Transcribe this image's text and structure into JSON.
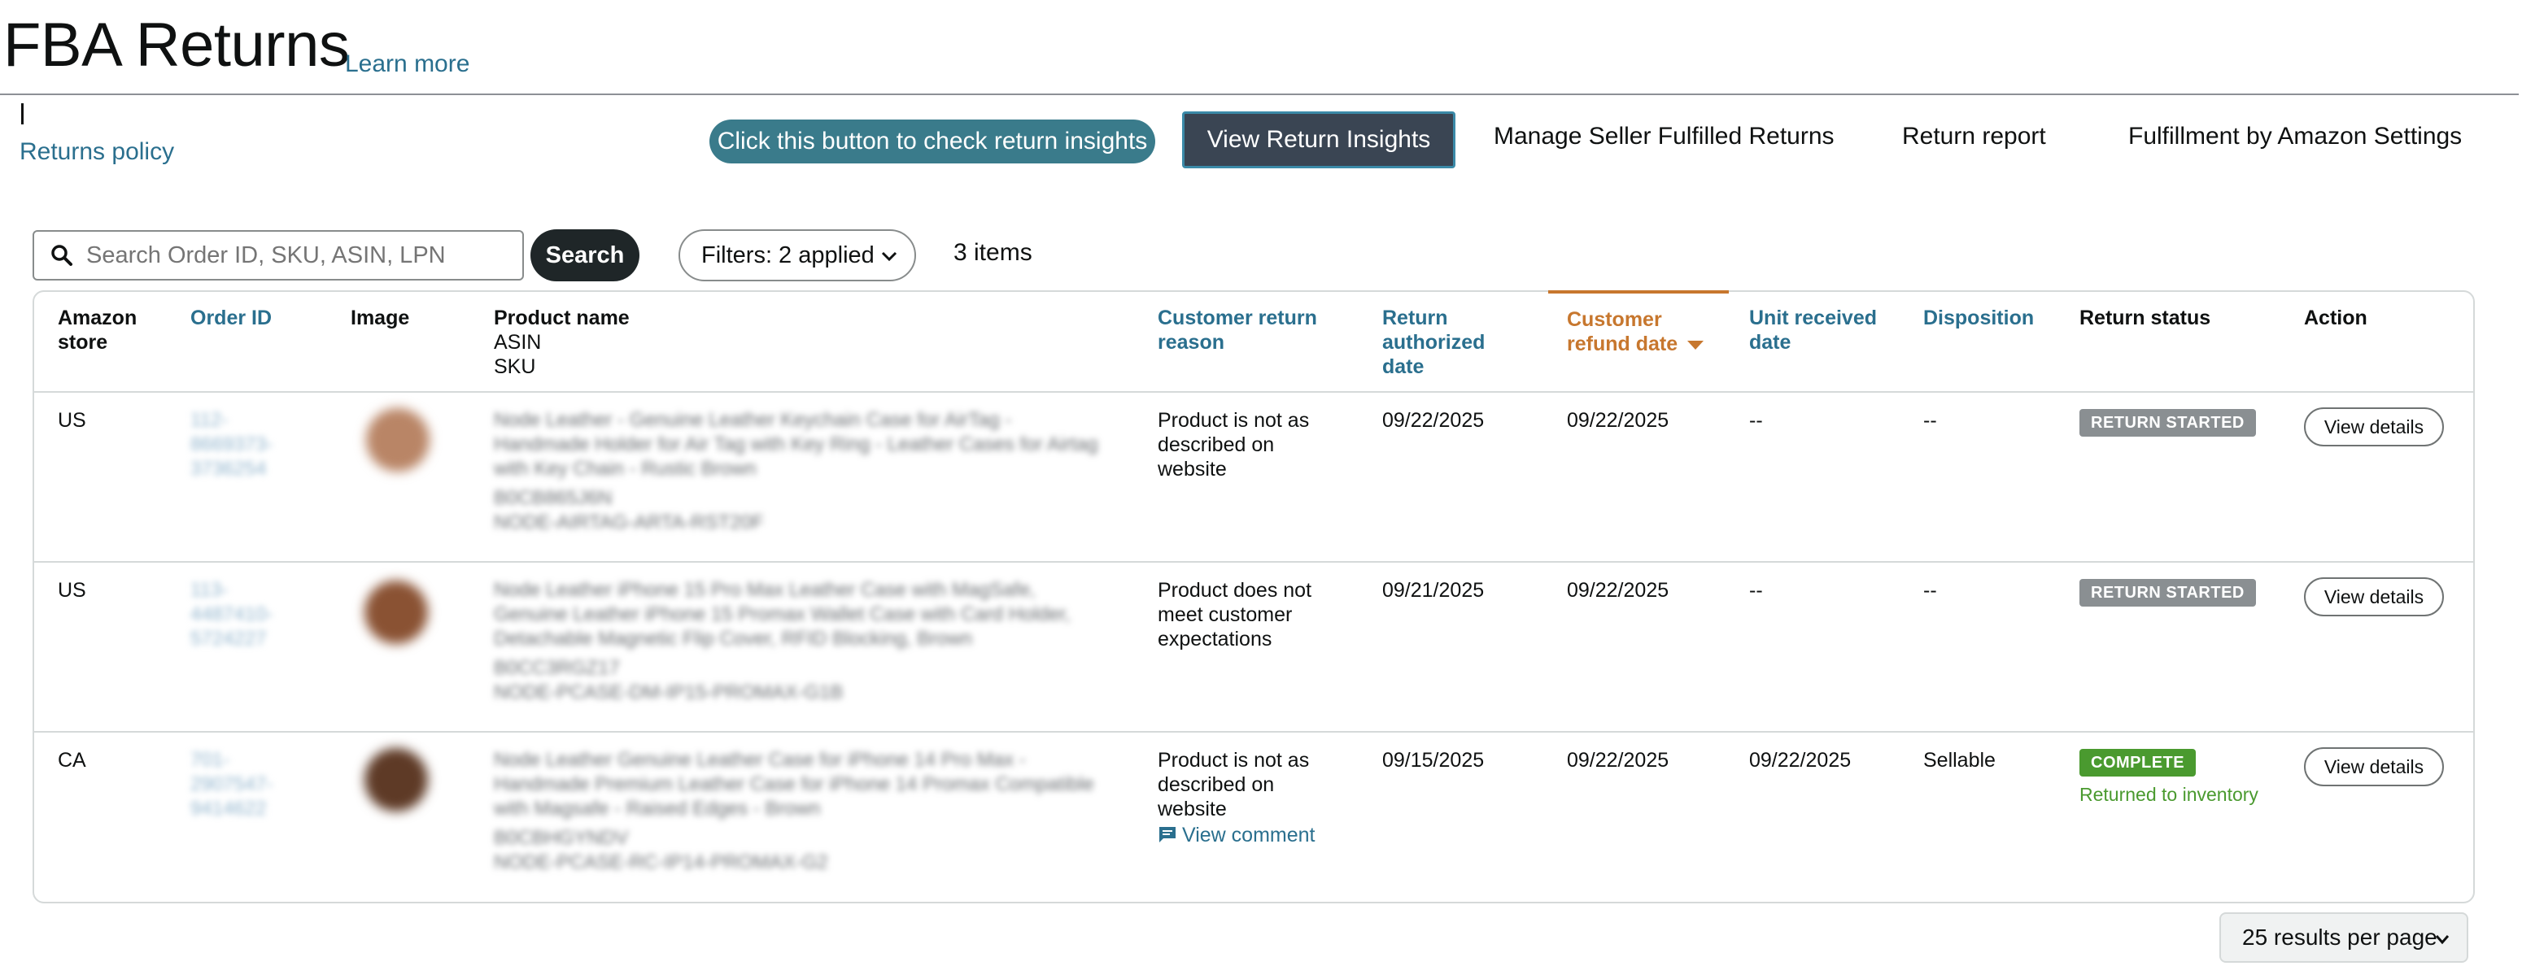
{
  "header": {
    "title": "FBA Returns",
    "learn_more": "Learn more",
    "returns_policy": "Returns policy"
  },
  "actions": {
    "hint": "Click this button to check return insights",
    "insights_button": "View Return Insights",
    "links": [
      "Manage Seller Fulfilled Returns",
      "Return report",
      "Fulfillment by Amazon Settings"
    ]
  },
  "search": {
    "placeholder": "Search Order ID, SKU, ASIN, LPN",
    "button": "Search",
    "filters": "Filters: 2 applied",
    "count": "3 items"
  },
  "table": {
    "headers": {
      "store": [
        "Amazon",
        "store"
      ],
      "order_id": "Order ID",
      "image": "Image",
      "product": [
        "Product name",
        "ASIN",
        "SKU"
      ],
      "reason": [
        "Customer return",
        "reason"
      ],
      "authorized": [
        "Return",
        "authorized",
        "date"
      ],
      "refund": [
        "Customer",
        "refund date"
      ],
      "received": [
        "Unit received",
        "date"
      ],
      "disposition": "Disposition",
      "status": "Return status",
      "action": "Action"
    },
    "rows": [
      {
        "store": "US",
        "order_id": [
          "112-",
          "8669373-",
          "3736254"
        ],
        "product": [
          "Node Leather - Genuine Leather Keychain Case for AirTag -",
          "Handmade Holder for Air Tag with Key Ring - Leather Cases for Airtag",
          "with Key Chain - Rustic Brown"
        ],
        "asin": "B0CB865J6N",
        "sku": "NODE-AIRTAG-ARTA-RST20F",
        "reason": [
          "Product is not as",
          "described on",
          "website"
        ],
        "authorized": "09/22/2025",
        "refund": "09/22/2025",
        "received": "--",
        "disposition": "--",
        "status": "RETURN STARTED",
        "action": "View details",
        "thumb_color": "#b98566"
      },
      {
        "store": "US",
        "order_id": [
          "113-",
          "4487410-",
          "5724227"
        ],
        "product": [
          "Node Leather iPhone 15 Pro Max Leather Case with MagSafe,",
          "Genuine Leather iPhone 15 Promax Wallet Case with Card Holder,",
          "Detachable Magnetic Flip Cover, RFID Blocking, Brown"
        ],
        "asin": "B0CC3RGZ17",
        "sku": "NODE-PCASE-DM-IP15-PROMAX-G1B",
        "reason": [
          "Product does not",
          "meet customer",
          "expectations"
        ],
        "authorized": "09/21/2025",
        "refund": "09/22/2025",
        "received": "--",
        "disposition": "--",
        "status": "RETURN STARTED",
        "action": "View details",
        "thumb_color": "#8a5233"
      },
      {
        "store": "CA",
        "order_id": [
          "701-",
          "2907547-",
          "9414622"
        ],
        "product": [
          "Node Leather Genuine Leather Case for iPhone 14 Pro Max -",
          "Handmade Premium Leather Case for iPhone 14 Promax Compatible",
          "with Magsafe - Raised Edges - Brown"
        ],
        "asin": "B0CBHGYNDV",
        "sku": "NODE-PCASE-RC-IP14-PROMAX-G2",
        "reason": [
          "Product is not as",
          "described on",
          "website"
        ],
        "comment": "View comment",
        "authorized": "09/15/2025",
        "refund": "09/22/2025",
        "received": "09/22/2025",
        "disposition": "Sellable",
        "status": "COMPLETE",
        "status_sub": "Returned to inventory",
        "action": "View details",
        "thumb_color": "#5e3a26"
      }
    ]
  },
  "pagination": {
    "per_page": "25 results per page"
  },
  "colors": {
    "link": "#2a6f8e",
    "sorted": "#c7772e",
    "complete": "#4a9a2f",
    "started": "#8a8f92"
  }
}
